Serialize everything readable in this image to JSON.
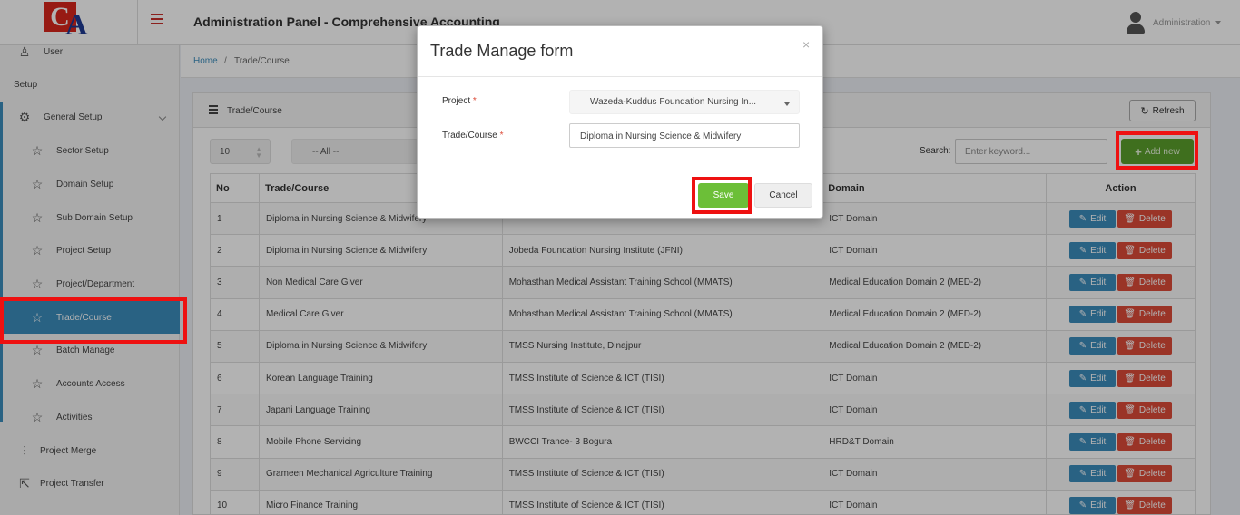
{
  "header": {
    "title": "Administration Panel - Comprehensive Accounting",
    "user_name": "Administration",
    "logo": {
      "letter1": "C",
      "letter2": "A"
    }
  },
  "sidebar": {
    "top_item": "User",
    "section_label": "Setup",
    "group_label": "General Setup",
    "items": [
      {
        "label": "Sector Setup"
      },
      {
        "label": "Domain Setup"
      },
      {
        "label": "Sub Domain Setup"
      },
      {
        "label": "Project Setup"
      },
      {
        "label": "Project/Department"
      },
      {
        "label": "Trade/Course"
      },
      {
        "label": "Batch Manage"
      },
      {
        "label": "Accounts Access"
      },
      {
        "label": "Activities"
      }
    ],
    "bottom_items": [
      {
        "label": "Project Merge"
      },
      {
        "label": "Project Transfer"
      }
    ]
  },
  "breadcrumb": {
    "home": "Home",
    "separator": "/",
    "current": "Trade/Course"
  },
  "panel": {
    "title": "Trade/Course",
    "refresh_label": "Refresh",
    "page_size": "10",
    "filter_value": "-- All --",
    "search_label": "Search:",
    "search_placeholder": "Enter keyword...",
    "add_label": "Add new"
  },
  "table": {
    "columns": [
      "No",
      "Trade/Course",
      "",
      "Domain",
      "Action"
    ],
    "edit_label": "Edit",
    "delete_label": "Delete",
    "rows": [
      {
        "no": "1",
        "trade": "Diploma in Nursing Science & Midwifery",
        "project": "",
        "domain": "ICT Domain"
      },
      {
        "no": "2",
        "trade": "Diploma in Nursing Science & Midwifery",
        "project": "Jobeda Foundation Nursing Institute (JFNI)",
        "domain": "ICT Domain"
      },
      {
        "no": "3",
        "trade": "Non Medical Care Giver",
        "project": "Mohasthan Medical Assistant Training School (MMATS)",
        "domain": "Medical Education Domain 2 (MED-2)"
      },
      {
        "no": "4",
        "trade": "Medical Care Giver",
        "project": "Mohasthan Medical Assistant Training School (MMATS)",
        "domain": "Medical Education Domain 2 (MED-2)"
      },
      {
        "no": "5",
        "trade": "Diploma in Nursing Science & Midwifery",
        "project": "TMSS Nursing Institute, Dinajpur",
        "domain": "Medical Education Domain 2 (MED-2)"
      },
      {
        "no": "6",
        "trade": "Korean Language Training",
        "project": "TMSS Institute of Science & ICT (TISI)",
        "domain": "ICT Domain"
      },
      {
        "no": "7",
        "trade": "Japani Language Training",
        "project": "TMSS Institute of Science & ICT (TISI)",
        "domain": "ICT Domain"
      },
      {
        "no": "8",
        "trade": "Mobile Phone Servicing",
        "project": "BWCCI Trance- 3 Bogura",
        "domain": "HRD&T Domain"
      },
      {
        "no": "9",
        "trade": "Grameen Mechanical Agriculture Training",
        "project": "TMSS Institute of Science & ICT (TISI)",
        "domain": "ICT Domain"
      },
      {
        "no": "10",
        "trade": "Micro Finance Training",
        "project": "TMSS Institute of Science & ICT (TISI)",
        "domain": "ICT Domain"
      }
    ]
  },
  "modal": {
    "title": "Trade Manage form",
    "close": "×",
    "project_label": "Project",
    "project_value": "Wazeda-Kuddus Foundation Nursing In...",
    "trade_label": "Trade/Course",
    "trade_value": "Diploma in Nursing Science & Midwifery",
    "required_mark": "*",
    "save_label": "Save",
    "cancel_label": "Cancel"
  },
  "colors": {
    "accent": "#3c8dbc",
    "highlight": "#ee1111",
    "save": "#6cbf38",
    "add": "#5b9f2c",
    "delete": "#dd4b39"
  }
}
